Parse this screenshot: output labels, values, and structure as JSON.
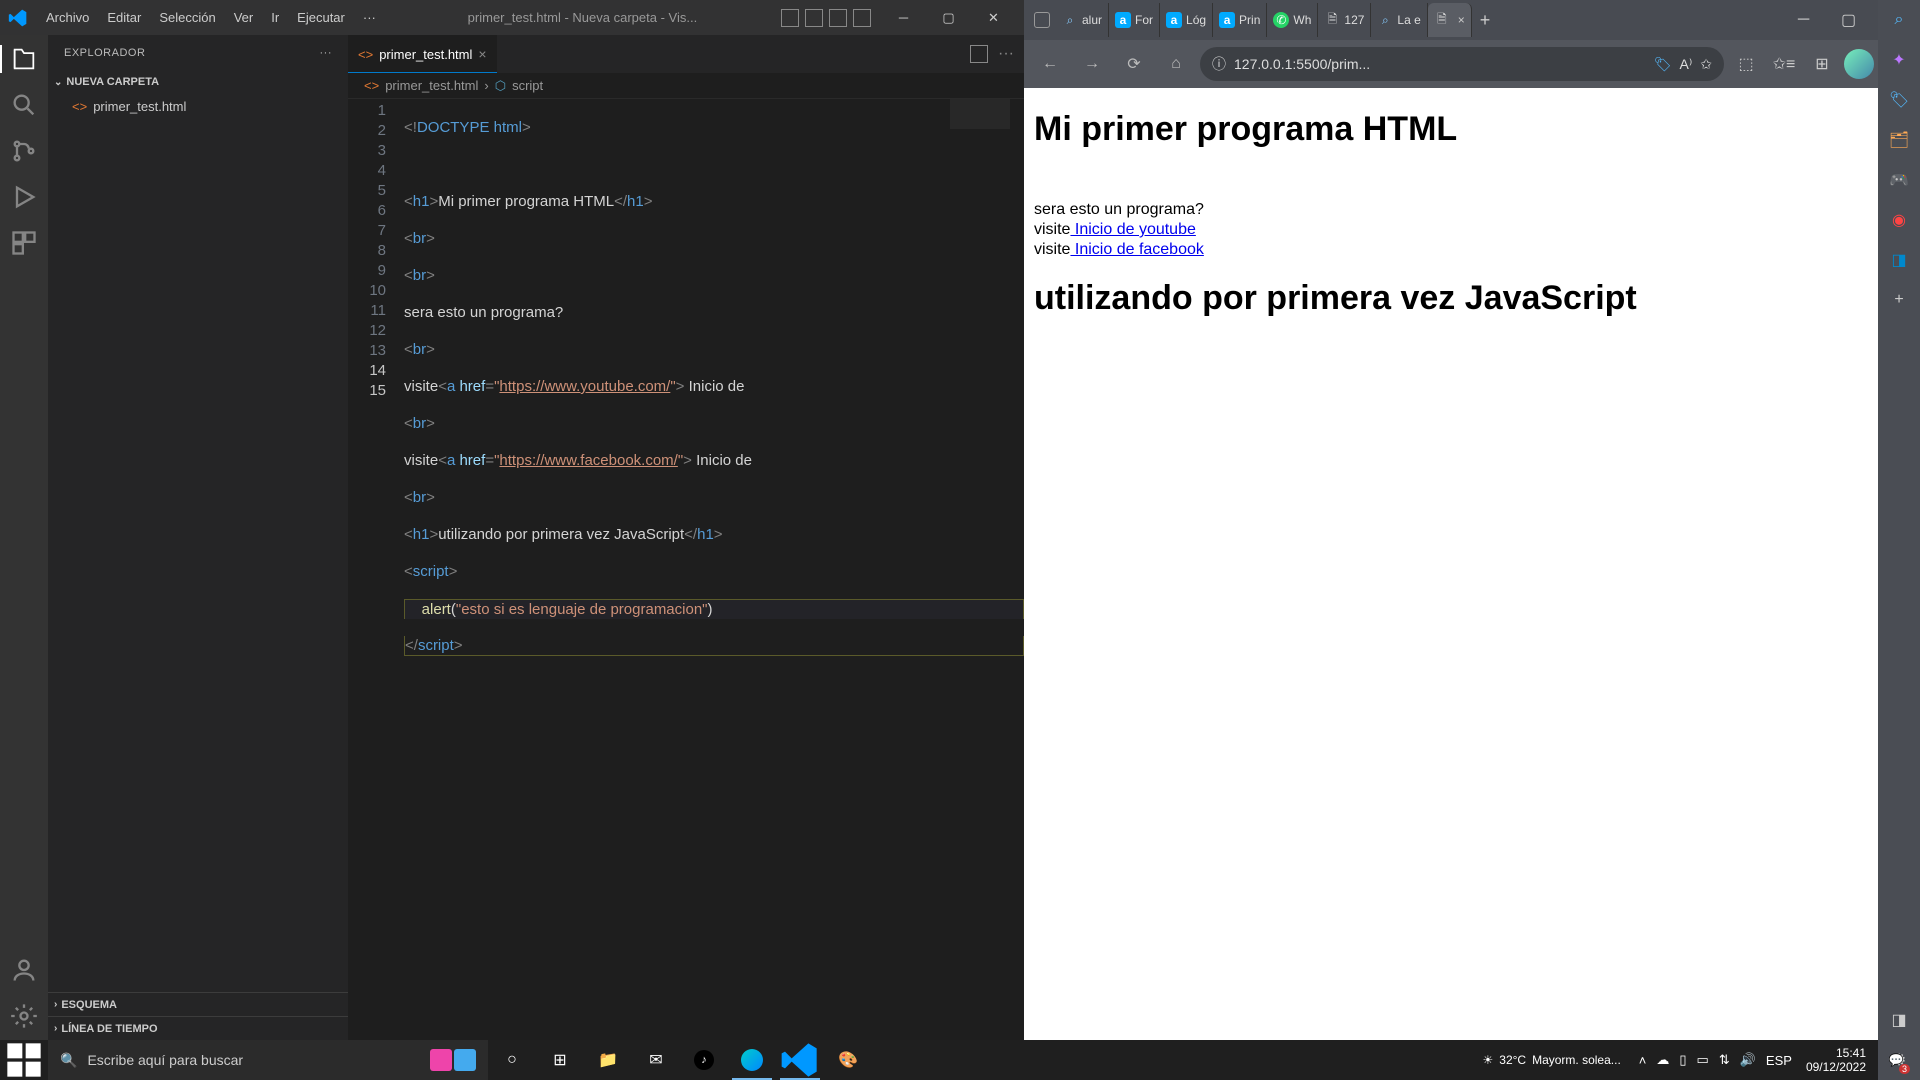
{
  "vscode": {
    "menus": [
      "Archivo",
      "Editar",
      "Selección",
      "Ver",
      "Ir",
      "Ejecutar",
      "···"
    ],
    "title": "primer_test.html - Nueva carpeta - Vis...",
    "explorer_label": "EXPLORADOR",
    "folder_name": "NUEVA CARPETA",
    "file_name": "primer_test.html",
    "outline_label": "ESQUEMA",
    "timeline_label": "LÍNEA DE TIEMPO",
    "tab_name": "primer_test.html",
    "breadcrumb_file": "primer_test.html",
    "breadcrumb_symbol": "script",
    "line_numbers": [
      "1",
      "2",
      "3",
      "4",
      "5",
      "6",
      "7",
      "8",
      "9",
      "10",
      "11",
      "12",
      "13",
      "14",
      "15"
    ]
  },
  "code": {
    "l1_doctype": "DOCTYPE ",
    "l1_html": "html",
    "l3_h1": "h1",
    "l3_text": "Mi primer programa HTML",
    "br": "br",
    "l6_text": "sera esto un programa?",
    "l8_pre": "visite",
    "a": "a",
    "href": "href",
    "l8_url": "https://www.youtube.com/",
    "l8_post": " Inicio de ",
    "l10_url": "https://www.facebook.com/",
    "l10_post": " Inicio de ",
    "l12_text": "utilizando por primera vez JavaScript",
    "script": "script",
    "alert": "alert",
    "l14_str": "esto si es lenguaje de programacion"
  },
  "browser": {
    "tabs": [
      "alur",
      "For",
      "Lóg",
      "Prin",
      "Wh",
      "127",
      "La e",
      ""
    ],
    "url": "127.0.0.1:5500/prim...",
    "page_h1": "Mi primer programa HTML",
    "page_q": "sera esto un programa?",
    "visite": "visite",
    "link_yt": " Inicio de youtube",
    "link_fb": " Inicio de facebook",
    "page_h2": "utilizando por primera vez JavaScript"
  },
  "taskbar": {
    "search_placeholder": "Escribe aquí para buscar",
    "weather_temp": "32°C",
    "weather_desc": "Mayorm. solea...",
    "lang": "ESP",
    "time": "15:41",
    "date": "09/12/2022",
    "notif_count": "3"
  }
}
